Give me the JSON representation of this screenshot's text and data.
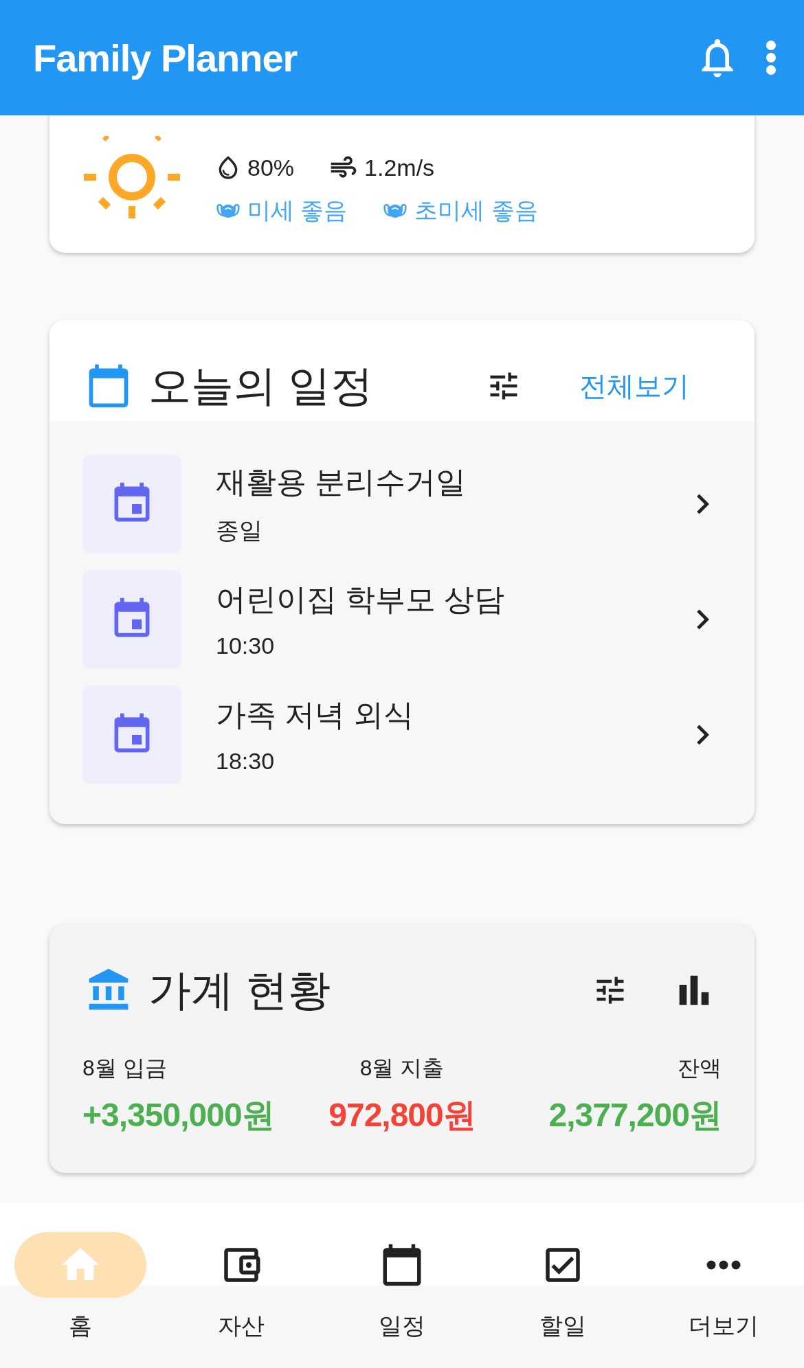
{
  "app_bar": {
    "title": "Family Planner"
  },
  "weather": {
    "humidity": "80%",
    "wind": "1.2m/s",
    "air_quality": [
      {
        "label": "미세 좋음"
      },
      {
        "label": "초미세 좋음"
      }
    ]
  },
  "schedule": {
    "title": "오늘의 일정",
    "view_all": "전체보기",
    "items": [
      {
        "title": "재활용 분리수거일",
        "time": "종일"
      },
      {
        "title": "어린이집 학부모 상담",
        "time": "10:30"
      },
      {
        "title": "가족 저녁 외식",
        "time": "18:30"
      }
    ]
  },
  "budget": {
    "title": "가계 현황",
    "stats": [
      {
        "label": "8월 입금",
        "value": "+3,350,000원",
        "color": "#4caf50"
      },
      {
        "label": "8월 지출",
        "value": "972,800원",
        "color": "#f44336"
      },
      {
        "label": "잔액",
        "value": "2,377,200원",
        "color": "#4caf50"
      }
    ]
  },
  "nav": [
    {
      "label": "홈",
      "selected": true
    },
    {
      "label": "자산",
      "selected": false
    },
    {
      "label": "일정",
      "selected": false
    },
    {
      "label": "할일",
      "selected": false
    },
    {
      "label": "더보기",
      "selected": false
    }
  ]
}
